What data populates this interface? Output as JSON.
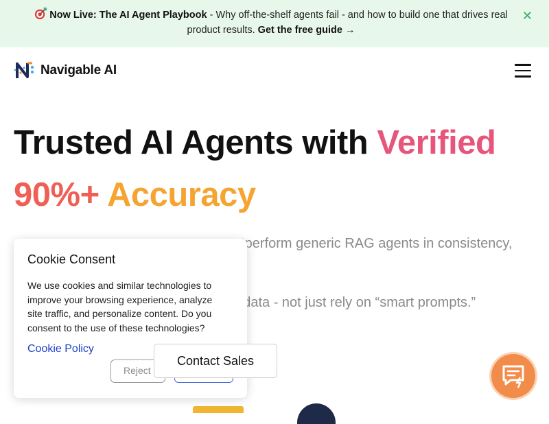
{
  "banner": {
    "emoji_icon": "target-icon",
    "highlight": "Now Live: The AI Agent Playbook",
    "body": " - Why off-the-shelf agents fail - and how to build one that drives real product results. ",
    "cta": "Get the free guide →",
    "close_icon": "close-icon",
    "background": "#e7f7e9"
  },
  "header": {
    "logo_text": "Navigable AI",
    "logo_icon": "navigable-logo-icon",
    "menu_icon": "hamburger-menu-icon"
  },
  "hero": {
    "title_part1": "Trusted AI Agents with ",
    "title_highlight": "Verified",
    "title_line2_a": "90%+ ",
    "title_line2_b": "Accuracy",
    "subtitle_fragment_1": "utperform generic RAG agents in consistency,",
    "subtitle_fragment_2": "r data - not just rely on “smart prompts.”"
  },
  "cookie": {
    "title": "Cookie Consent",
    "body": "We use cookies and similar technologies to improve your browsing experience, analyze site traffic, and personalize content. Do you consent to the use of these technologies?",
    "policy_link": "Cookie Policy",
    "reject_label": "Reject"
  },
  "actions": {
    "contact_sales": "Contact Sales",
    "chat_icon": "chat-support-icon"
  },
  "colors": {
    "accent_pink": "#e8557a",
    "accent_orange": "#f28b32",
    "link_blue": "#1d3fcc",
    "chat_orange": "#f28c4a"
  }
}
